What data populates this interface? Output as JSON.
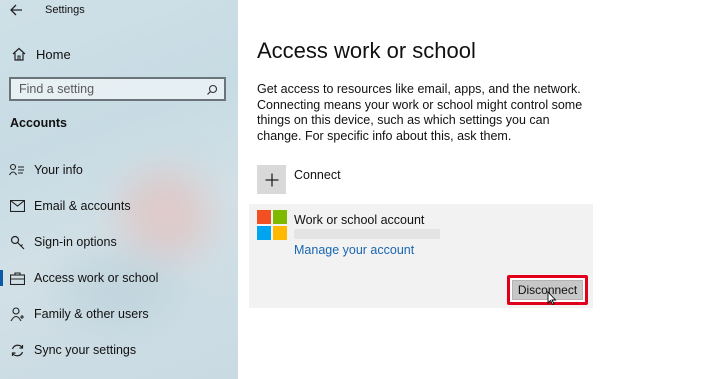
{
  "window": {
    "title": "Settings"
  },
  "sidebar": {
    "home_label": "Home",
    "search_placeholder": "Find a setting",
    "section_title": "Accounts",
    "items": [
      {
        "label": "Your info",
        "icon": "person-card-icon",
        "active": false
      },
      {
        "label": "Email & accounts",
        "icon": "envelope-icon",
        "active": false
      },
      {
        "label": "Sign-in options",
        "icon": "key-icon",
        "active": false
      },
      {
        "label": "Access work or school",
        "icon": "briefcase-icon",
        "active": true
      },
      {
        "label": "Family & other users",
        "icon": "person-plus-icon",
        "active": false
      },
      {
        "label": "Sync your settings",
        "icon": "sync-icon",
        "active": false
      }
    ]
  },
  "main": {
    "title": "Access work or school",
    "description": "Get access to resources like email, apps, and the network. Connecting means your work or school might control some things on this device, such as which settings you can change. For specific info about this, ask them.",
    "connect_label": "Connect",
    "account": {
      "name": "Work or school account",
      "manage_link": "Manage your account",
      "disconnect_label": "Disconnect"
    }
  },
  "colors": {
    "accent": "#0a5aa8",
    "link": "#1a67b0",
    "highlight": "#e0001a",
    "ms_red": "#f25022",
    "ms_green": "#7fba00",
    "ms_blue": "#00a4ef",
    "ms_yellow": "#ffb900"
  }
}
